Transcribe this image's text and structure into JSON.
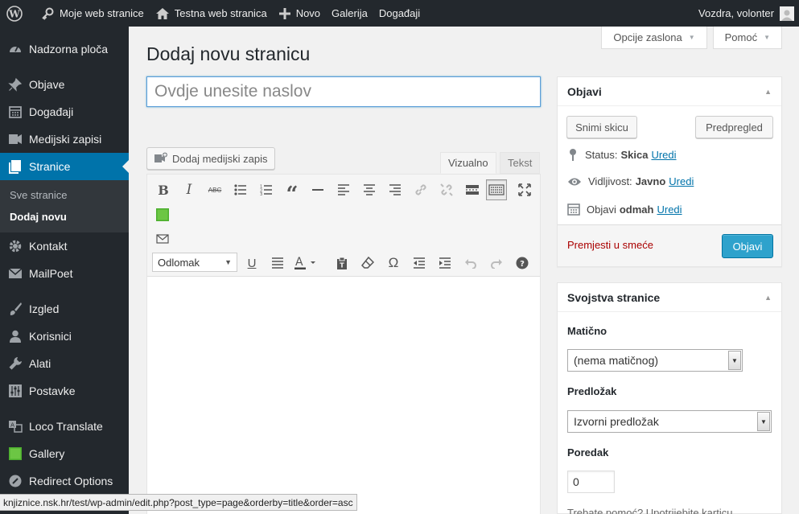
{
  "adminbar": {
    "site_name": "Moje web stranice",
    "network_site": "Testna web stranica",
    "new_label": "Novo",
    "gallery_label": "Galerija",
    "events_label": "Događaji",
    "user_greeting": "Vozdra, volonter"
  },
  "sidebar": {
    "items": [
      {
        "label": "Nadzorna ploča",
        "icon": "dashboard-icon"
      },
      {
        "label": "Objave",
        "icon": "pin-icon"
      },
      {
        "label": "Događaji",
        "icon": "calendar-icon"
      },
      {
        "label": "Medijski zapisi",
        "icon": "media-icon"
      },
      {
        "label": "Stranice",
        "icon": "pages-icon"
      },
      {
        "label": "Kontakt",
        "icon": "cog-icon"
      },
      {
        "label": "MailPoet",
        "icon": "mail-icon"
      },
      {
        "label": "Izgled",
        "icon": "brush-icon"
      },
      {
        "label": "Korisnici",
        "icon": "user-icon"
      },
      {
        "label": "Alati",
        "icon": "wrench-icon"
      },
      {
        "label": "Postavke",
        "icon": "settings-icon"
      },
      {
        "label": "Loco Translate",
        "icon": "translate-icon"
      },
      {
        "label": "Gallery",
        "icon": "gallery-icon"
      },
      {
        "label": "Redirect Options",
        "icon": "redirect-icon"
      }
    ],
    "submenu": {
      "all_pages": "Sve stranice",
      "add_new": "Dodaj novu"
    }
  },
  "screen_options": {
    "options_label": "Opcije zaslona",
    "help_label": "Pomoć"
  },
  "page_title": "Dodaj novu stranicu",
  "title_placeholder": "Ovdje unesite naslov",
  "editor": {
    "add_media": "Dodaj medijski zapis",
    "tab_visual": "Vizualno",
    "tab_text": "Tekst",
    "format_value": "Odlomak"
  },
  "publish": {
    "title": "Objavi",
    "save_draft": "Snimi skicu",
    "preview": "Predpregled",
    "status_label": "Status:",
    "status_value": "Skica",
    "visibility_label": "Vidljivost:",
    "visibility_value": "Javno",
    "publish_label": "Objavi",
    "publish_value": "odmah",
    "edit_link": "Uredi",
    "trash": "Premjesti u smeće",
    "publish_button": "Objavi"
  },
  "attributes": {
    "title": "Svojstva stranice",
    "parent_label": "Matično",
    "parent_value": "(nema matičnog)",
    "template_label": "Predložak",
    "template_value": "Izvorni predložak",
    "order_label": "Poredak",
    "order_value": "0",
    "cut_text": "Trebate pomoć? Upotrijebite karticu"
  },
  "statusbar": "knjiznice.nsk.hr/test/wp-admin/edit.php?post_type=page&orderby=title&order=asc",
  "colors": {
    "adminbar_bg": "#23282d",
    "accent": "#0073aa",
    "publish_button": "#2ea2cc",
    "trash_link": "#aa0000"
  }
}
